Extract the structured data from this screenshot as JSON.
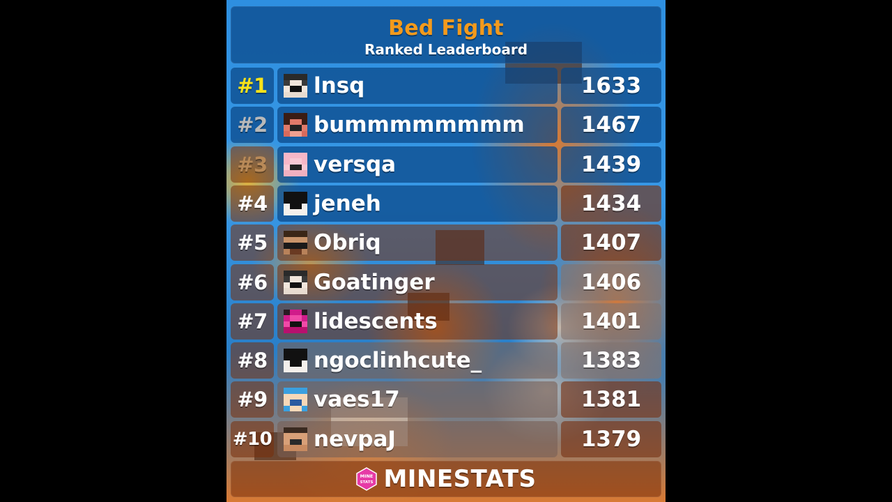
{
  "header": {
    "title": "Bed Fight",
    "subtitle": "Ranked Leaderboard"
  },
  "colors": {
    "title": "#f39a1c",
    "rank_1": "#f7e21a",
    "rank_2": "#b9b9b9",
    "rank_3": "#b98a58",
    "rank_default": "#ffffff",
    "brand": "#e63aa6"
  },
  "leaderboard": [
    {
      "rank": "#1",
      "name": "lnsq",
      "score": "1633",
      "head": "dark-hair-icon"
    },
    {
      "rank": "#2",
      "name": "bummmmmmmm",
      "score": "1467",
      "head": "red-face-icon"
    },
    {
      "rank": "#3",
      "name": "versqa",
      "score": "1439",
      "head": "pink-face-icon"
    },
    {
      "rank": "#4",
      "name": "jeneh",
      "score": "1434",
      "head": "black-hair-icon"
    },
    {
      "rank": "#5",
      "name": "Obriq",
      "score": "1407",
      "head": "sunglasses-face-icon"
    },
    {
      "rank": "#6",
      "name": "Goatinger",
      "score": "1406",
      "head": "dark-hair-icon"
    },
    {
      "rank": "#7",
      "name": "lidescents",
      "score": "1401",
      "head": "magenta-face-icon"
    },
    {
      "rank": "#8",
      "name": "ngoclinhcute_",
      "score": "1383",
      "head": "black-hair-icon"
    },
    {
      "rank": "#9",
      "name": "vaes17",
      "score": "1381",
      "head": "blue-hood-icon"
    },
    {
      "rank": "#10",
      "name": "nevpaJ",
      "score": "1379",
      "head": "tan-face-icon"
    }
  ],
  "footer": {
    "logo_icon": "minestats-hexagon-icon",
    "logo_mark_top": "MINE",
    "logo_mark_bottom": "STATS",
    "brand": "MINESTATS"
  }
}
